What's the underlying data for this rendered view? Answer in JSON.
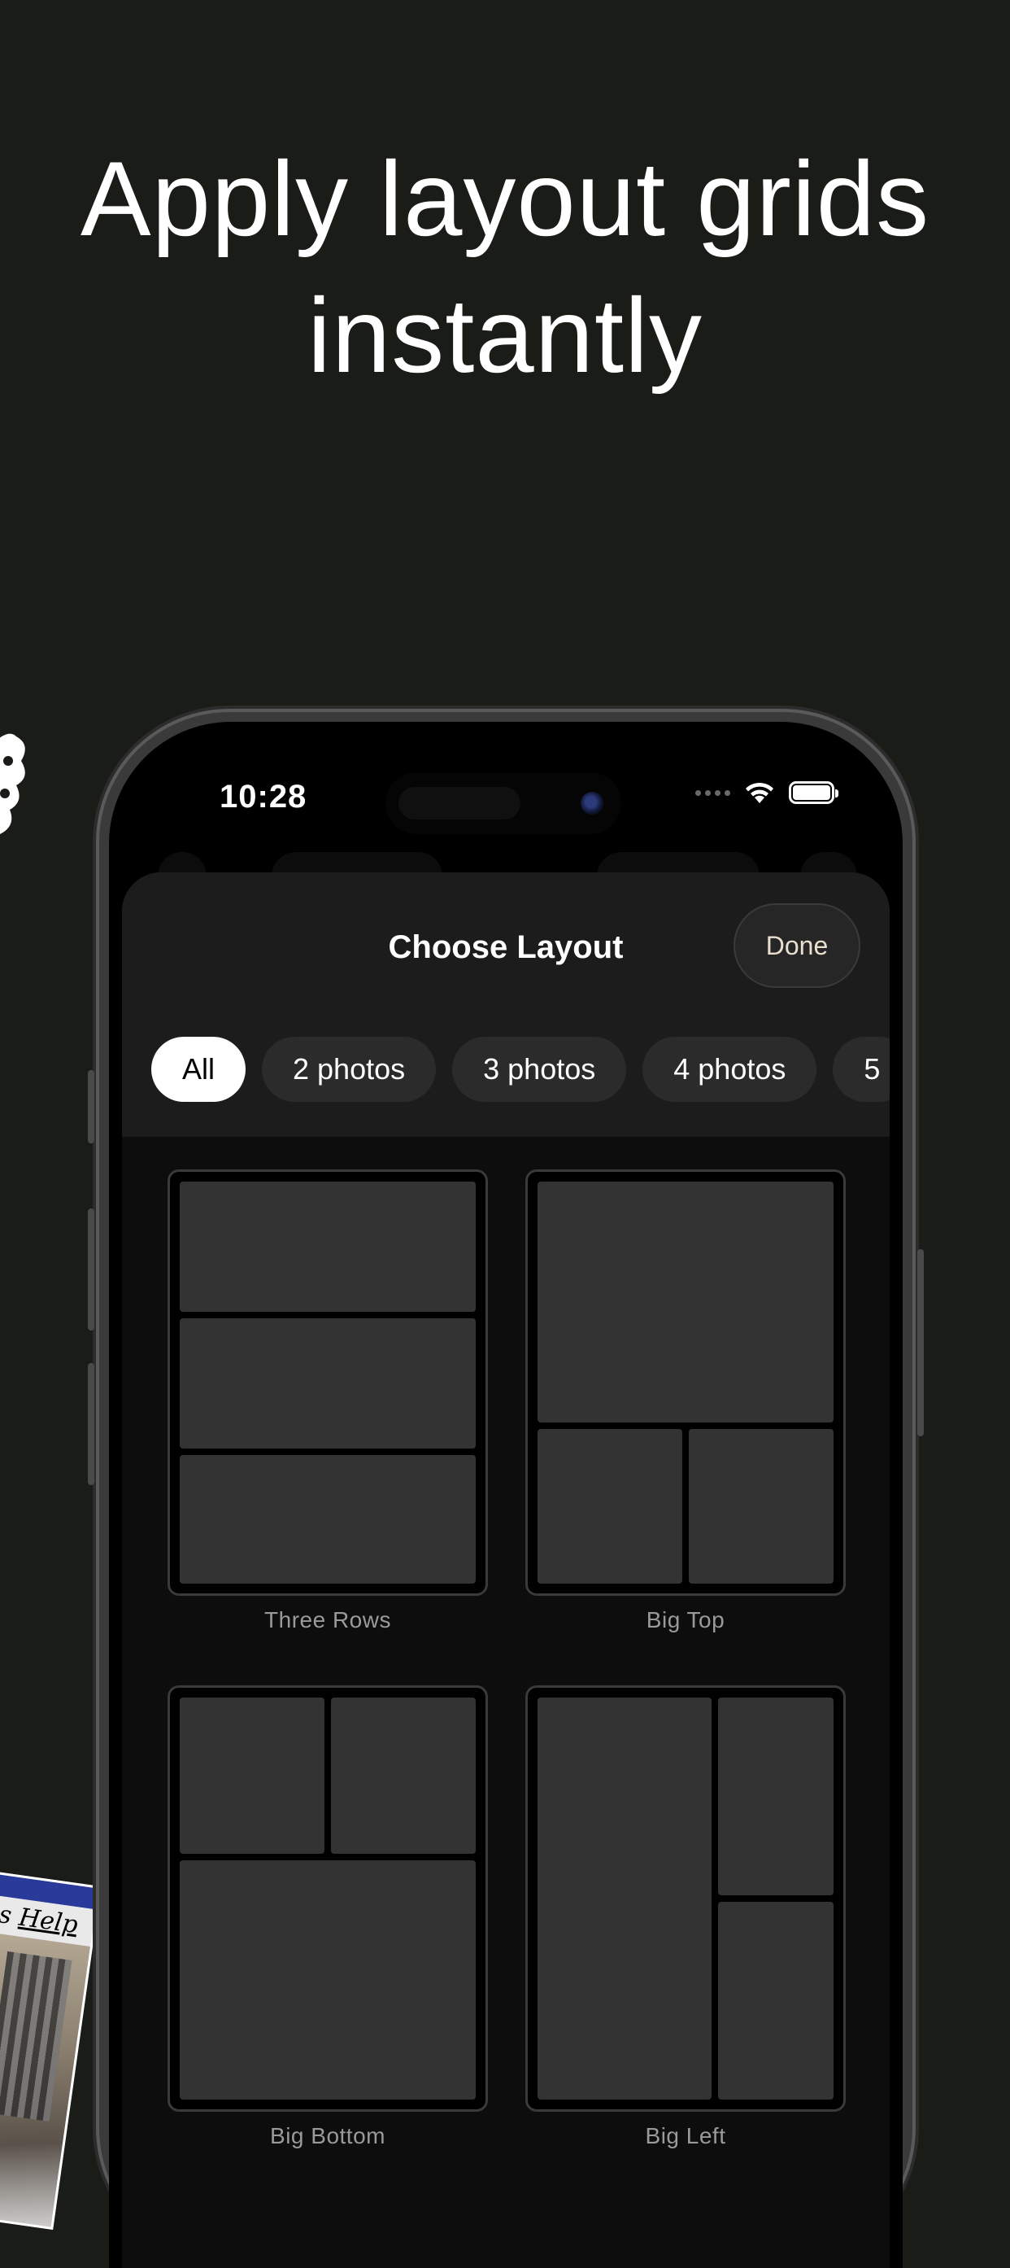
{
  "headline": {
    "line1": "Apply layout grids",
    "line2": "instantly"
  },
  "decor": {
    "window_menu_partial": "ons",
    "window_menu_help": "Help"
  },
  "status_bar": {
    "time": "10:28",
    "wifi_icon": "wifi-icon",
    "battery_icon": "battery-icon"
  },
  "sheet": {
    "title": "Choose Layout",
    "done_label": "Done",
    "filters": [
      {
        "label": "All",
        "selected": true
      },
      {
        "label": "2 photos",
        "selected": false
      },
      {
        "label": "3 photos",
        "selected": false
      },
      {
        "label": "4 photos",
        "selected": false
      },
      {
        "label": "5",
        "selected": false
      }
    ],
    "layouts": [
      {
        "name": "Three Rows"
      },
      {
        "name": "Big Top"
      },
      {
        "name": "Big Bottom"
      },
      {
        "name": "Big Left"
      }
    ]
  },
  "colors": {
    "page_background": "#1a1c18",
    "sheet_background": "#1c1c1c",
    "cell_fill": "#333333",
    "selected_chip": "#ffffff",
    "done_text": "#e9dfcf"
  }
}
